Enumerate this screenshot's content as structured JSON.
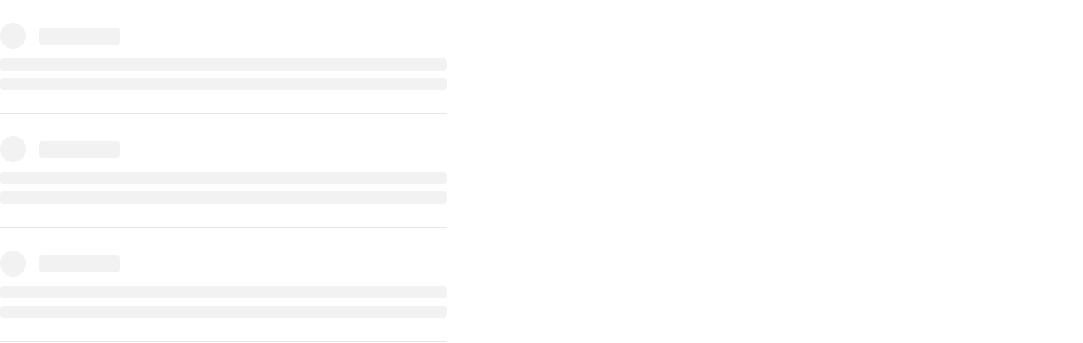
{
  "skeleton": {
    "colors": {
      "placeholder": "#f2f2f2",
      "divider": "#e6e6e6",
      "background": "#ffffff"
    },
    "items": [
      {
        "avatar": "avatar-placeholder",
        "title": "",
        "lines": [
          "",
          ""
        ]
      },
      {
        "avatar": "avatar-placeholder",
        "title": "",
        "lines": [
          "",
          ""
        ]
      },
      {
        "avatar": "avatar-placeholder",
        "title": "",
        "lines": [
          "",
          ""
        ]
      }
    ]
  }
}
